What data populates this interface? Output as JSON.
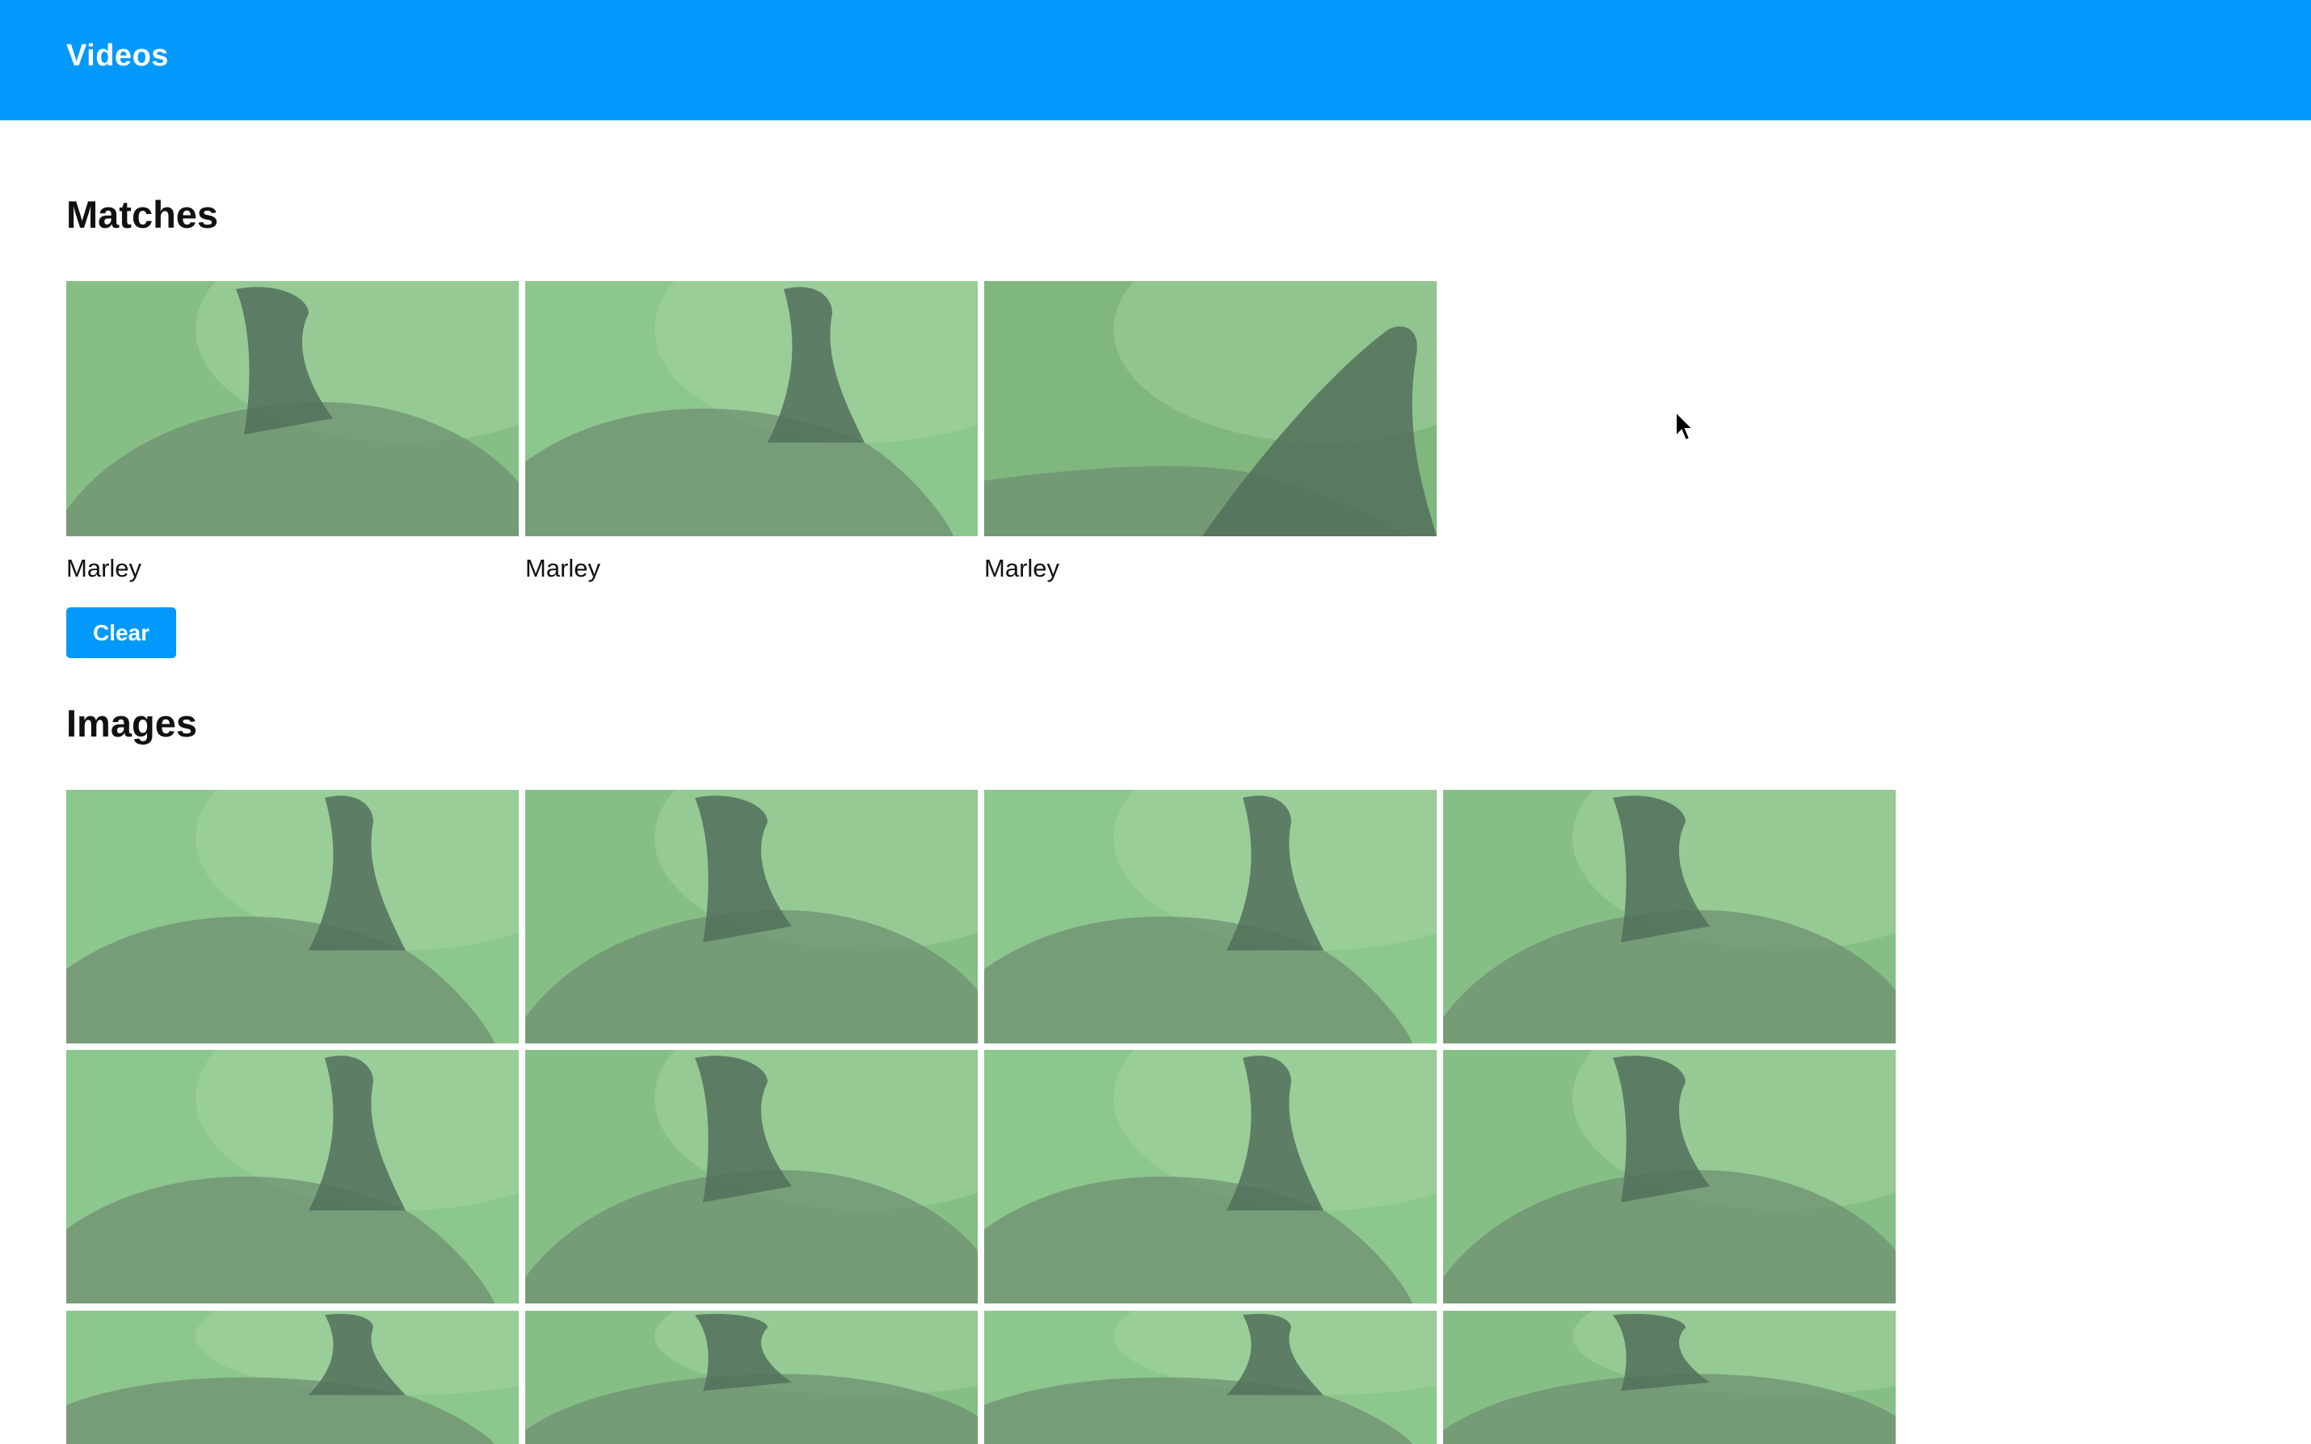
{
  "header": {
    "title": "Videos",
    "background": "#0299fd"
  },
  "matches": {
    "title": "Matches",
    "items": [
      {
        "label": "Marley"
      },
      {
        "label": "Marley"
      },
      {
        "label": "Marley"
      }
    ],
    "clear_label": "Clear"
  },
  "images": {
    "title": "Images",
    "count_visible": 12
  },
  "icons": {
    "cursor": "mouse-pointer-icon"
  }
}
